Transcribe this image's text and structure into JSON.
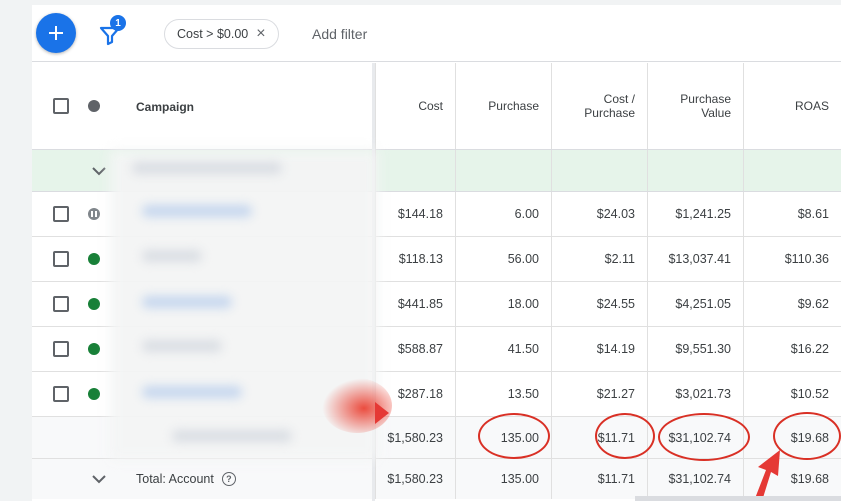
{
  "toolbar": {
    "add_button": "+",
    "filter_count": "1",
    "filter_chip": "Cost > $0.00",
    "chip_close": "×",
    "add_filter": "Add filter"
  },
  "columns": {
    "campaign": "Campaign",
    "cost": "Cost",
    "purchase": "Purchase",
    "cost_per_purchase_1": "Cost /",
    "cost_per_purchase_2": "Purchase",
    "purchase_value_1": "Purchase",
    "purchase_value_2": "Value",
    "roas": "ROAS"
  },
  "rows": [
    {
      "status": "paused",
      "cost": "$144.18",
      "purchase": "6.00",
      "cpp": "$24.03",
      "pv": "$1,241.25",
      "roas": "$8.61"
    },
    {
      "status": "enabled",
      "cost": "$118.13",
      "purchase": "56.00",
      "cpp": "$2.11",
      "pv": "$13,037.41",
      "roas": "$110.36"
    },
    {
      "status": "enabled",
      "cost": "$441.85",
      "purchase": "18.00",
      "cpp": "$24.55",
      "pv": "$4,251.05",
      "roas": "$9.62"
    },
    {
      "status": "enabled",
      "cost": "$588.87",
      "purchase": "41.50",
      "cpp": "$14.19",
      "pv": "$9,551.30",
      "roas": "$16.22"
    },
    {
      "status": "enabled",
      "cost": "$287.18",
      "purchase": "13.50",
      "cpp": "$21.27",
      "pv": "$3,021.73",
      "roas": "$10.52"
    }
  ],
  "subtotal": {
    "cost": "$1,580.23",
    "purchase": "135.00",
    "cpp": "$11.71",
    "pv": "$31,102.74",
    "roas": "$19.68"
  },
  "total": {
    "label": "Total: Account",
    "help": "?",
    "cost": "$1,580.23",
    "purchase": "135.00",
    "cpp": "$11.71",
    "pv": "$31,102.74",
    "roas": "$19.68"
  },
  "colors": {
    "accent": "#1a73e8",
    "enabled": "#188038",
    "annotation": "#d93025",
    "group_row": "#e6f4ea"
  }
}
